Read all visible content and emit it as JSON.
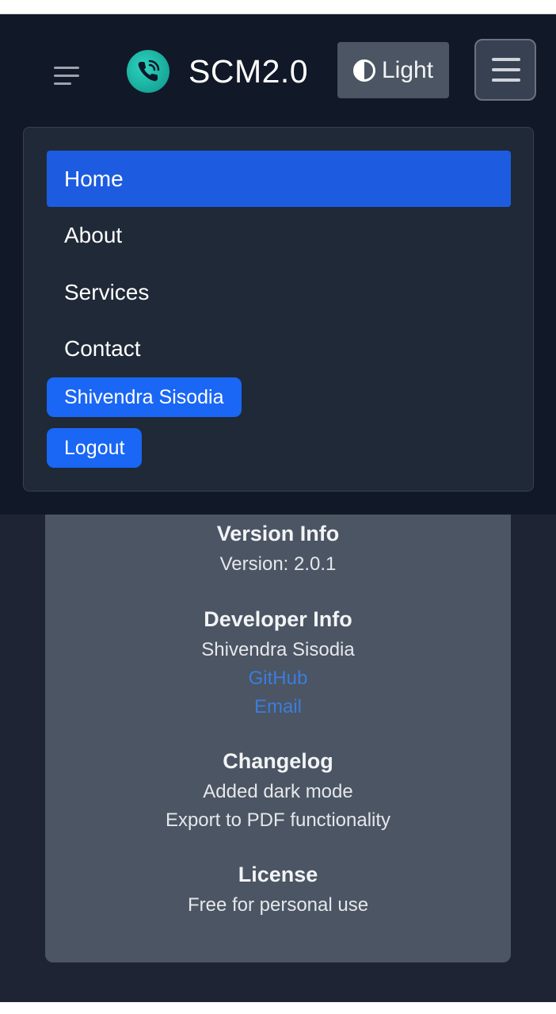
{
  "navbar": {
    "brand": "SCM2.0",
    "theme_label": "Light",
    "icons": {
      "sidebar": "sidebar-toggle-icon",
      "logo": "phone-logo-icon",
      "theme": "half-circle-theme-icon",
      "menu": "hamburger-menu-icon"
    }
  },
  "menu": {
    "items": [
      "Home",
      "About",
      "Services",
      "Contact"
    ],
    "user_name": "Shivendra Sisodia",
    "logout": "Logout"
  },
  "content": {
    "version": {
      "title": "Version Info",
      "value": "Version: 2.0.1"
    },
    "developer": {
      "title": "Developer Info",
      "name": "Shivendra Sisodia",
      "github": "GitHub",
      "email": "Email"
    },
    "changelog": {
      "title": "Changelog",
      "items": [
        "Added dark mode",
        "Export to PDF functionality"
      ]
    },
    "license": {
      "title": "License",
      "value": "Free for personal use"
    }
  },
  "colors": {
    "navbar_bg": "#111827",
    "page_bg": "#1e2433",
    "card_bg": "#4b5563",
    "accent": "#1d5ce0",
    "link": "#3b7ddd"
  }
}
